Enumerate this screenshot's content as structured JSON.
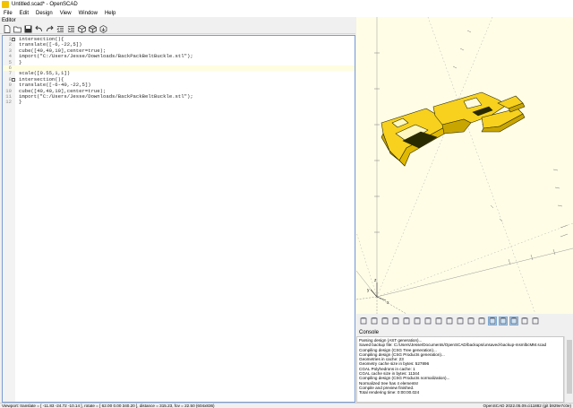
{
  "window": {
    "title": "Untitled.scad* - OpenSCAD"
  },
  "menu": [
    "File",
    "Edit",
    "Design",
    "View",
    "Window",
    "Help"
  ],
  "editor": {
    "panel_title": "Editor",
    "toolbar": [
      {
        "name": "new-file-icon"
      },
      {
        "name": "open-file-icon"
      },
      {
        "name": "save-icon"
      },
      {
        "name": "undo-icon"
      },
      {
        "name": "redo-icon"
      },
      {
        "name": "unindent-icon"
      },
      {
        "name": "indent-icon"
      },
      {
        "name": "preview-icon"
      },
      {
        "name": "render-icon"
      },
      {
        "name": "export-stl-icon"
      }
    ],
    "lines": [
      {
        "n": "1",
        "fold": "−",
        "text": "intersection(){"
      },
      {
        "n": "2",
        "fold": "",
        "text": "translate([-6,-22,5])"
      },
      {
        "n": "3",
        "fold": "",
        "text": "cube([40,40,10],center=true);"
      },
      {
        "n": "4",
        "fold": "",
        "text": "import(\"C:/Users/Jesse/Downloads/BackPackBeltBuckle.stl\");"
      },
      {
        "n": "5",
        "fold": "",
        "text": "}"
      },
      {
        "n": "6",
        "fold": "",
        "text": ""
      },
      {
        "n": "7",
        "fold": "",
        "text": "scale([0.55,1,1])"
      },
      {
        "n": "8",
        "fold": "−",
        "text": "intersection(){"
      },
      {
        "n": "9",
        "fold": "",
        "text": "translate([-6-40,-22,5])"
      },
      {
        "n": "10",
        "fold": "",
        "text": "cube([40,40,10],center=true);"
      },
      {
        "n": "11",
        "fold": "",
        "text": "import(\"C:/Users/Jesse/Downloads/BackPackBeltBuckle.stl\");"
      },
      {
        "n": "12",
        "fold": "",
        "text": "}"
      }
    ]
  },
  "viewport": {
    "axis_labels": {
      "z": "z",
      "y": "y",
      "x": "x"
    },
    "model_color": "#f7d11e",
    "model_edge_color": "#2a2a00"
  },
  "view_toolbar": [
    {
      "name": "view-all-icon"
    },
    {
      "name": "view-reset-icon"
    },
    {
      "name": "zoom-in-icon"
    },
    {
      "name": "zoom-out-icon"
    },
    {
      "name": "rotate-icon"
    },
    {
      "name": "reset-view-icon"
    },
    {
      "name": "view-right-icon"
    },
    {
      "name": "view-top-icon"
    },
    {
      "name": "view-bottom-icon"
    },
    {
      "name": "view-left-icon"
    },
    {
      "name": "view-front-icon"
    },
    {
      "name": "view-back-icon"
    },
    {
      "name": "perspective-icon",
      "active": true
    },
    {
      "name": "orthogonal-icon",
      "active": true
    },
    {
      "name": "show-axes-icon",
      "active": true
    },
    {
      "name": "show-scale-icon"
    },
    {
      "name": "show-edges-icon"
    }
  ],
  "console": {
    "title": "Console",
    "lines": [
      "Parsing design (AST generation)...",
      "Saved backup file: C:/Users/Jesse/Documents/OpenSCAD/backups/unsaved-backup-msmlbcMM.scad",
      "Compiling design (CSG Tree generation)...",
      "Compiling design (CSG Products generation)...",
      "Geometries in cache: 23",
      "Geometry cache size in bytes: 527896",
      "CGAL Polyhedrons in cache: 1",
      "CGAL cache size in bytes: 11344",
      "Compiling design (CSG Products normalization)...",
      "Normalized tree has 4 elements!",
      "Compile and preview finished.",
      "Total rendering time: 0:00:00.024"
    ]
  },
  "statusbar": {
    "left": "Viewport: translate = [ -11.83 -24.72 -10.14 ], rotate = [ 62.00 0.00 340.20 ], distance = 315.23, fov = 22.50 (604x836)",
    "right": "OpenSCAD 2022.05.09.ci11882 (git b929e7c0e)"
  }
}
